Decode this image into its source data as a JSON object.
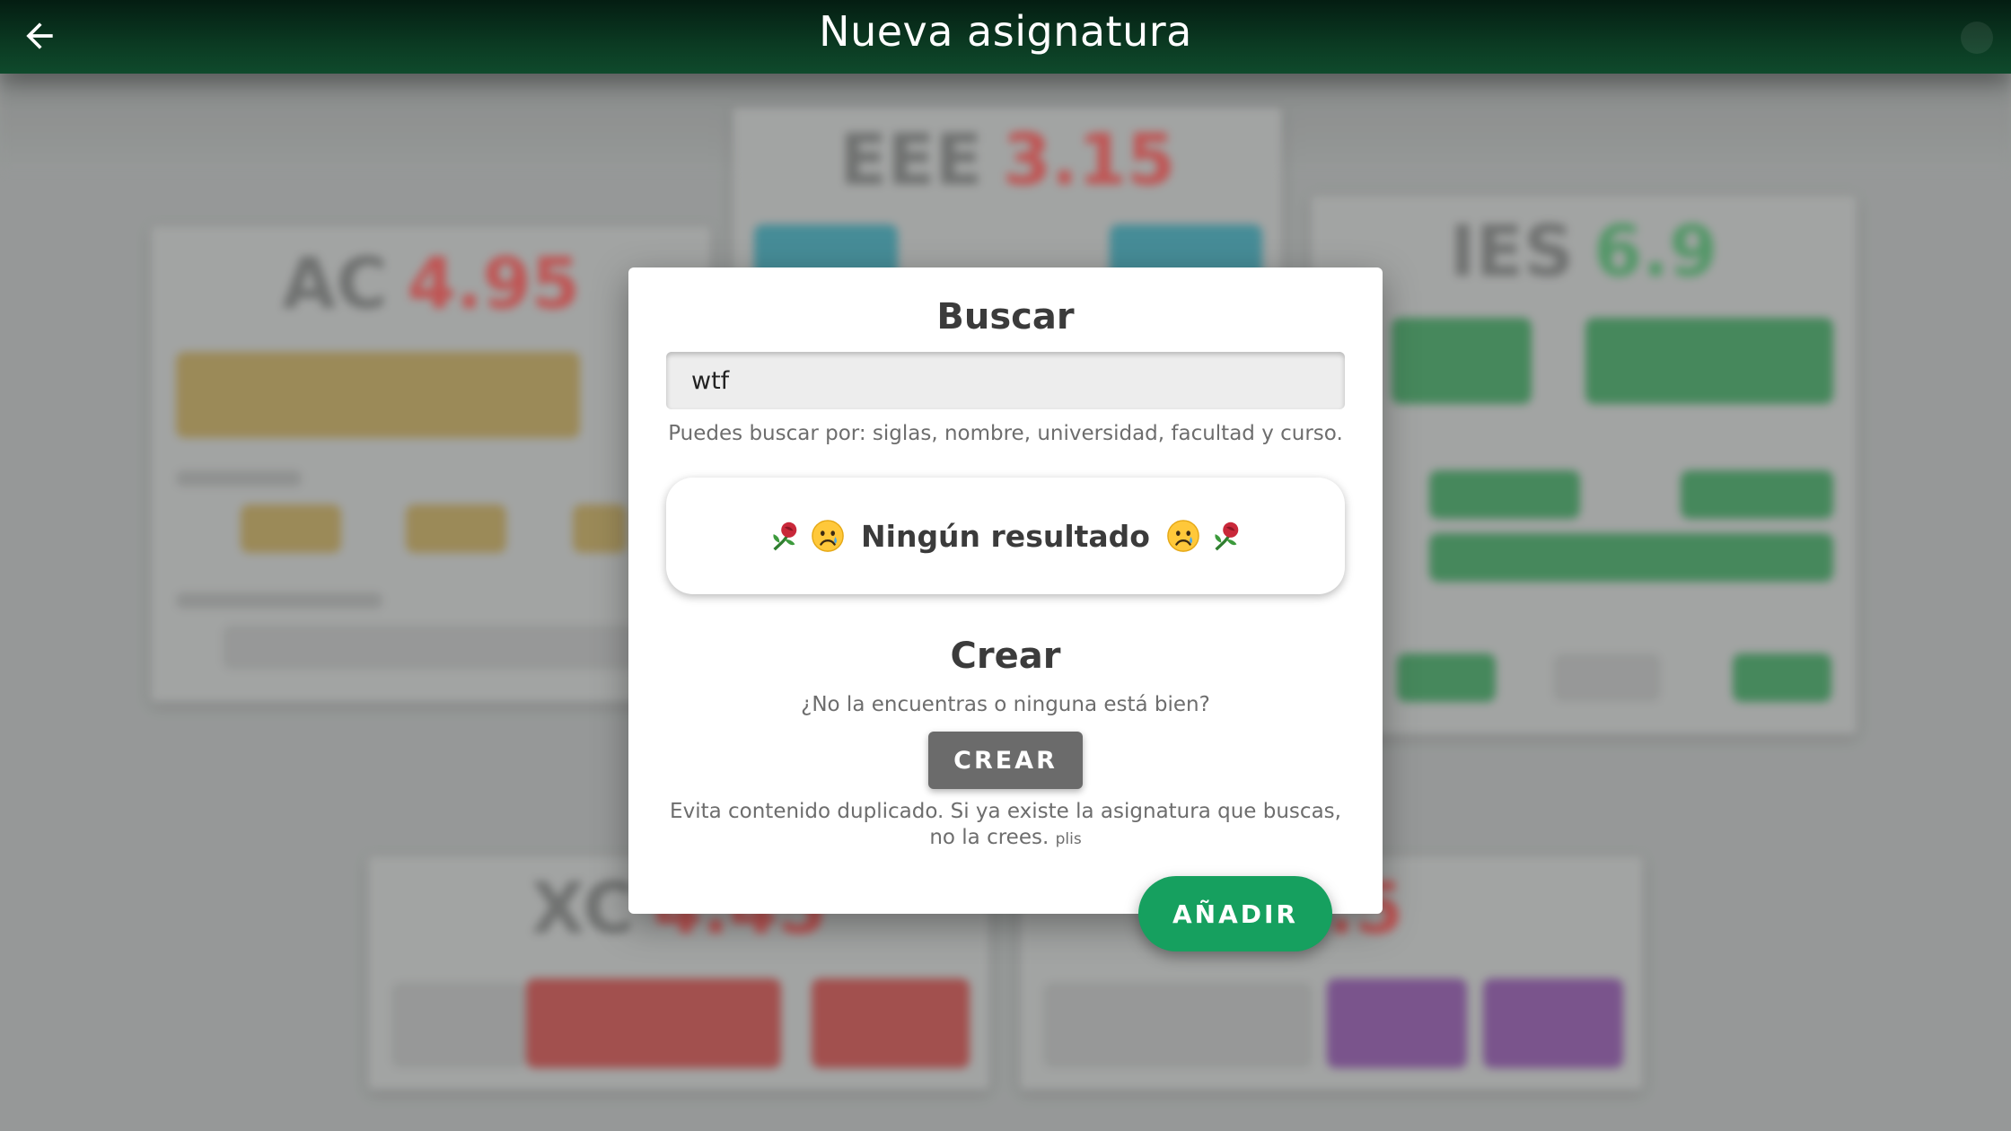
{
  "app_bar": {
    "title": "Nueva asignatura",
    "back_icon": "arrow-left-icon"
  },
  "background_cards": [
    {
      "acronym": "AC",
      "grade": "4.95",
      "grade_color": "#c9504f"
    },
    {
      "acronym": "EEE",
      "grade": "3.15",
      "grade_color": "#c9504f"
    },
    {
      "acronym": "IES",
      "grade": "6.9",
      "grade_color": "#4f9c66"
    },
    {
      "acronym": "XC",
      "grade": "4.45",
      "grade_color": "#c9504f"
    },
    {
      "acronym": "",
      "grade": "3.5",
      "grade_color": "#c9504f"
    }
  ],
  "dialog": {
    "search_heading": "Buscar",
    "search_value": "wtf",
    "search_hint": "Puedes buscar por: siglas, nombre, universidad, facultad y curso.",
    "no_result_text": "Ningún resultado",
    "create_heading": "Crear",
    "create_question": "¿No la encuentras o ninguna está bien?",
    "create_button": "CREAR",
    "warning_text": "Evita contenido duplicado. Si ya existe la asignatura que buscas, no la crees.",
    "warning_small": "plis"
  },
  "fab": {
    "label": "AÑADIR",
    "color": "#16a05f"
  },
  "colors": {
    "appbar": "#0b3a22",
    "accent": "#16a05f",
    "gold": "#a08c54",
    "red": "#a84a48",
    "purple": "#7a4f8f"
  }
}
